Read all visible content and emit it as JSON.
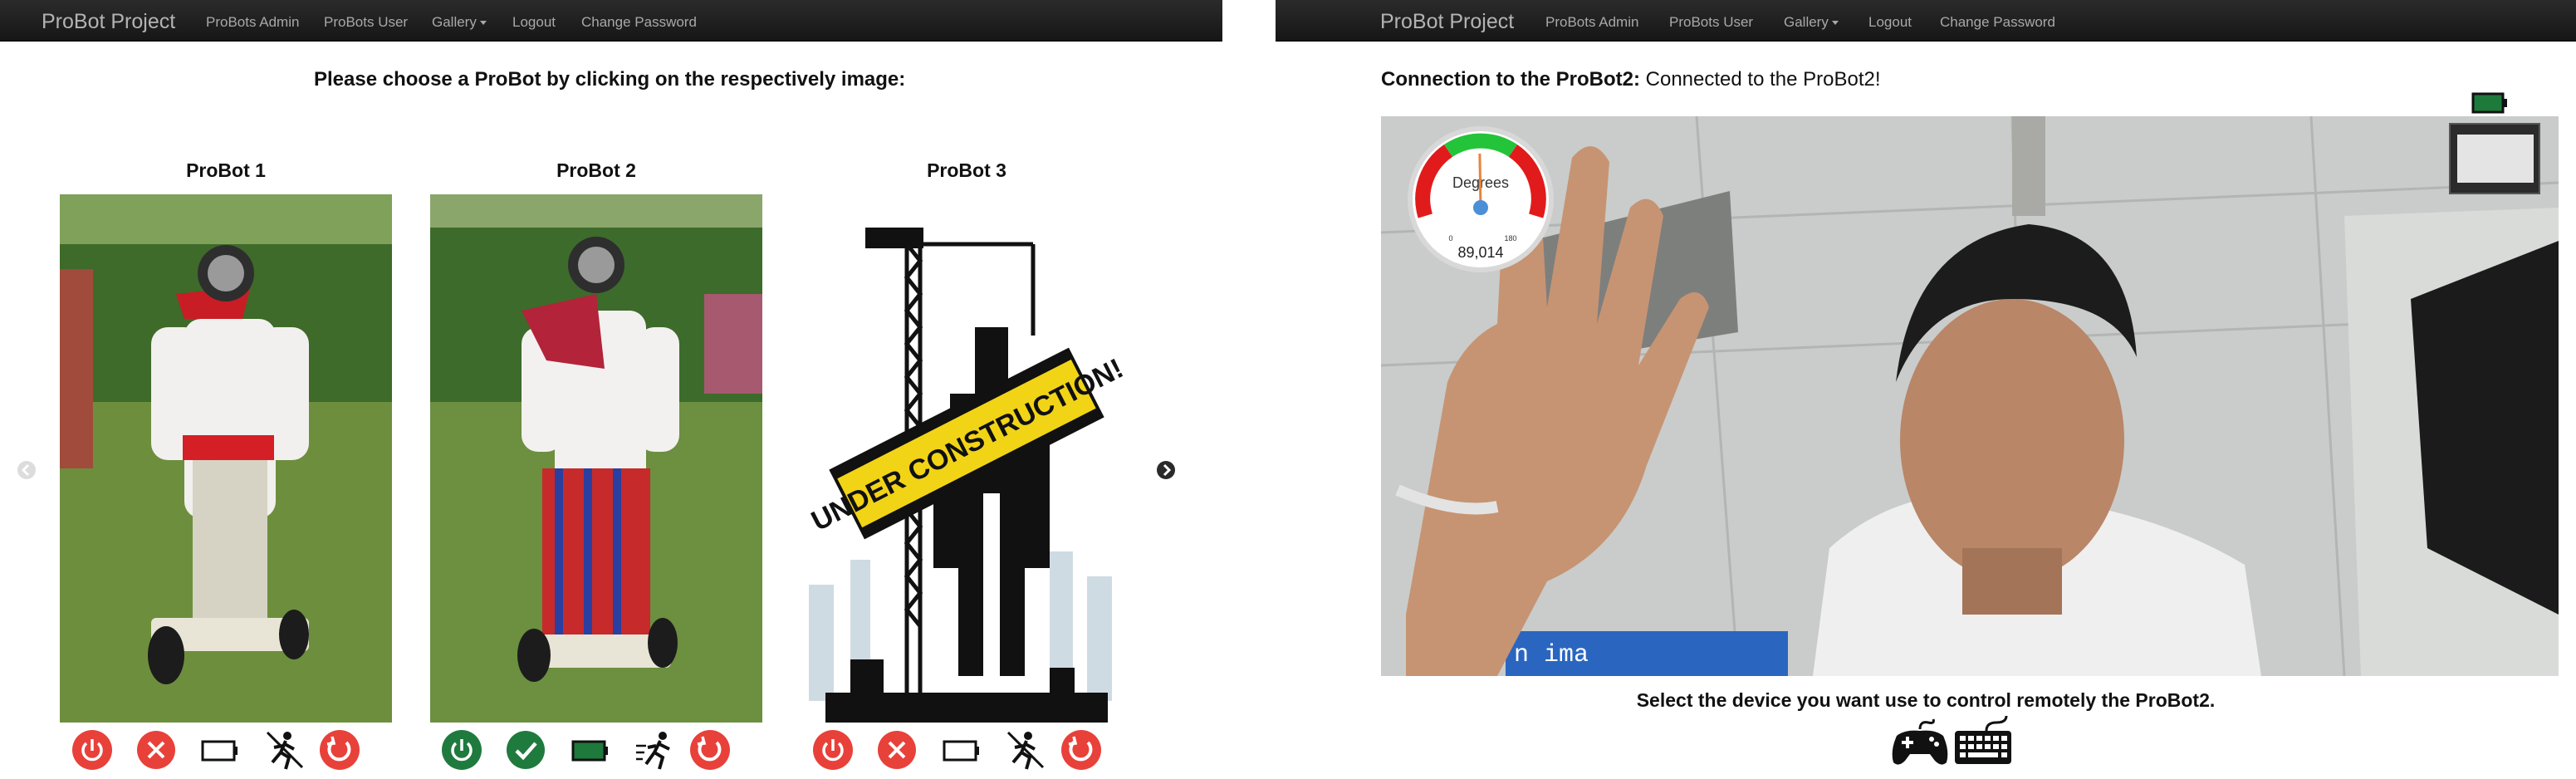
{
  "left": {
    "nav": {
      "brand": "ProBot Project",
      "items": [
        "ProBots Admin",
        "ProBots User",
        "Gallery",
        "Logout",
        "Change Password"
      ]
    },
    "prompt": "Please choose a ProBot by clicking on the respectively image:",
    "bots": [
      {
        "title": "ProBot 1"
      },
      {
        "title": "ProBot 2"
      },
      {
        "title": "ProBot 3"
      }
    ],
    "banner_text": "UNDER CONSTRUCTION!"
  },
  "right": {
    "nav": {
      "brand": "ProBot Project",
      "items": [
        "ProBots Admin",
        "ProBots User",
        "Gallery",
        "Logout",
        "Change Password"
      ]
    },
    "connection_label": "Connection to the ProBot2:",
    "connection_status": "Connected to the ProBot2!",
    "gauge": {
      "title": "Degrees",
      "min_label": "0",
      "max_label": "180",
      "value_text": "89,014",
      "value": 89.014,
      "min": 0,
      "max": 180
    },
    "video_overlay_text": "n ima",
    "control_prompt": "Select the device you want use to control remotely the ProBot2."
  },
  "colors": {
    "navbar": "#1b1b1b",
    "red": "#e8413a",
    "green": "#1f7a3e",
    "battery_green": "#1d7a3b"
  }
}
